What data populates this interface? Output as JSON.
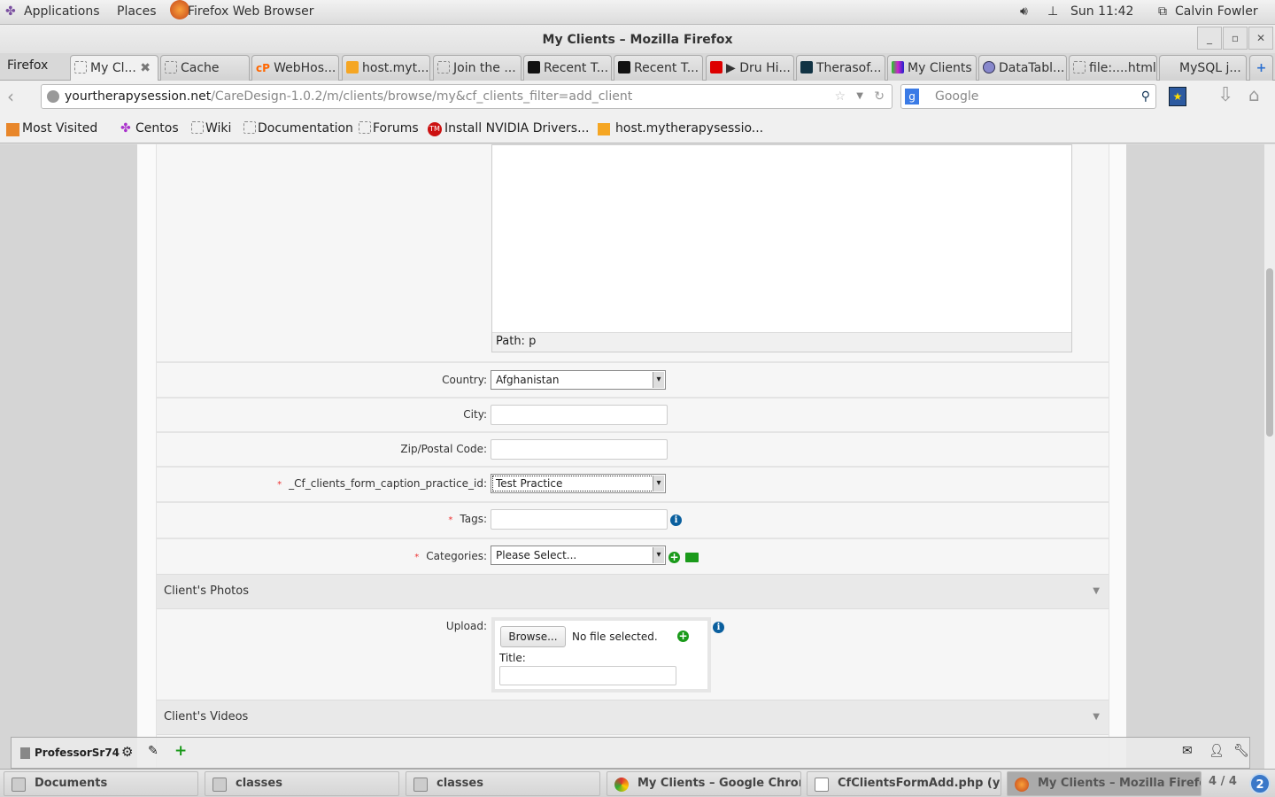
{
  "topbar": {
    "applications": "Applications",
    "places": "Places",
    "active_app": "Firefox Web Browser",
    "clock": "Sun 11:42",
    "user": "Calvin Fowler"
  },
  "window": {
    "title": "My Clients – Mozilla Firefox"
  },
  "tabs": {
    "menu": "Firefox",
    "items": [
      "My Cl...",
      "Cache",
      "WebHos...",
      "host.myt...",
      "Join the ...",
      "Recent T...",
      "Recent T...",
      "▶ Dru Hi...",
      "Therasof...",
      "My Clients",
      "DataTabl...",
      "file:....html",
      "MySQL j..."
    ]
  },
  "nav": {
    "url_domain": "yourtherapysession.net",
    "url_path": "/CareDesign-1.0.2/m/clients/browse/my&cf_clients_filter=add_client",
    "search_placeholder": "Google"
  },
  "bookmarks": [
    "Most Visited",
    "Centos",
    "Wiki",
    "Documentation",
    "Forums",
    "Install NVIDIA Drivers...",
    "host.mytherapysessio..."
  ],
  "form": {
    "editor_path": "Path: p",
    "country_label": "Country:",
    "country_value": "Afghanistan",
    "city_label": "City:",
    "zip_label": "Zip/Postal Code:",
    "practice_label": "_Cf_clients_form_caption_practice_id:",
    "practice_value": "Test Practice",
    "tags_label": "Tags:",
    "categories_label": "Categories:",
    "categories_value": "Please Select...",
    "required_mark": "*",
    "photos_section": "Client's Photos",
    "upload_label": "Upload:",
    "browse": "Browse...",
    "no_file": "No file selected.",
    "title_label": "Title:",
    "videos_section": "Client's Videos"
  },
  "chatbar": {
    "user": "ProfessorSr74"
  },
  "taskbar": {
    "items": [
      "Documents",
      "classes",
      "classes",
      "My Clients – Google Chrome",
      "CfClientsFormAdd.php (yo...",
      "My Clients – Mozilla Firefox"
    ],
    "workspace": "4 / 4",
    "badge": "2"
  }
}
